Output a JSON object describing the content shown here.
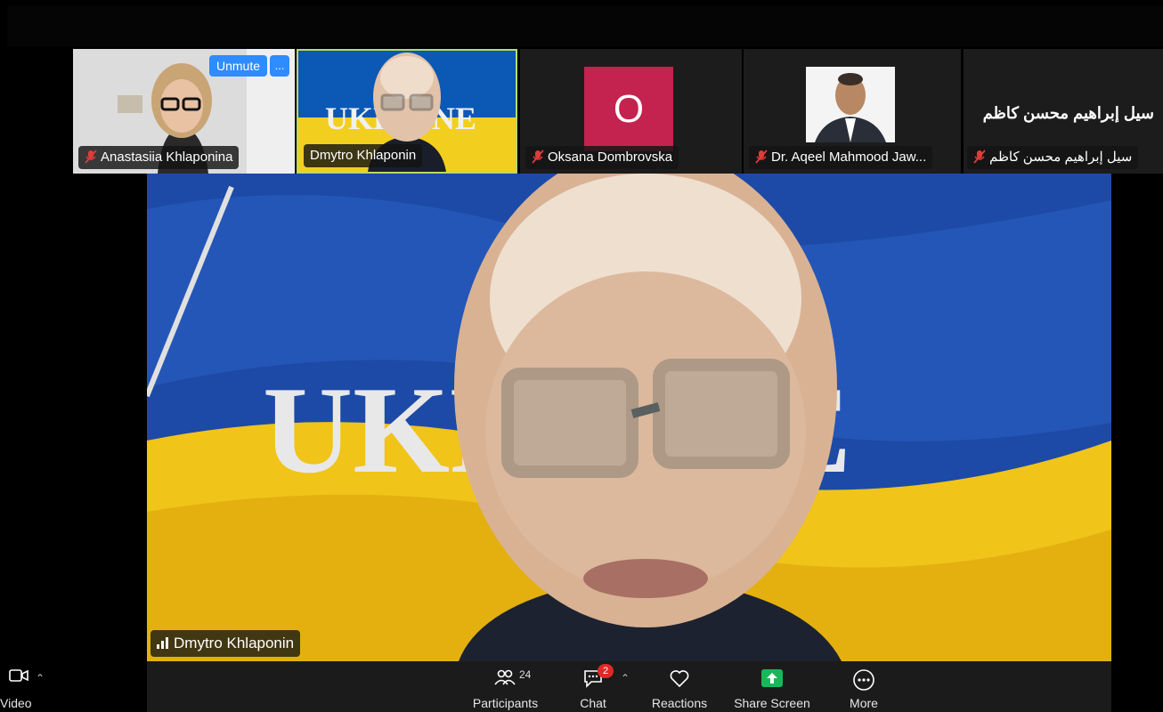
{
  "participants_tiles": [
    {
      "name": "Anastasiia Khlaponina",
      "muted": true
    },
    {
      "name": "Dmytro Khlaponin",
      "muted": false,
      "background_text": "UKRAINE"
    },
    {
      "name": "Oksana Dombrovska",
      "muted": true,
      "avatar_initial": "O"
    },
    {
      "name": "Dr. Aqeel Mahmood Jaw...",
      "muted": true
    },
    {
      "name": "سيل إبراهيم محسن كاظم",
      "muted": true,
      "title": "سيل إبراهيم محسن كاظم"
    }
  ],
  "self_view_controls": {
    "unmute_label": "Unmute",
    "more_label": "..."
  },
  "main_video": {
    "speaker_name": "Dmytro Khlaponin",
    "background_text": "UKRAINE"
  },
  "toolbar": {
    "video_label": "Video",
    "participants_label": "Participants",
    "participants_count": "24",
    "chat_label": "Chat",
    "chat_badge": "2",
    "reactions_label": "Reactions",
    "share_screen_label": "Share Screen",
    "more_label": "More"
  },
  "colors": {
    "accent_blue": "#2d8cff",
    "active_speaker_border": "#b9d96a",
    "avatar_bg": "#c4234f",
    "share_green": "#18b85a",
    "mute_red": "#e03b3b",
    "badge_red": "#e02828"
  },
  "icons": [
    "mic-muted-icon",
    "signal-bars-icon",
    "video-icon",
    "chevron-up-icon",
    "participants-icon",
    "chat-icon",
    "heart-icon",
    "share-screen-icon",
    "more-icon"
  ]
}
